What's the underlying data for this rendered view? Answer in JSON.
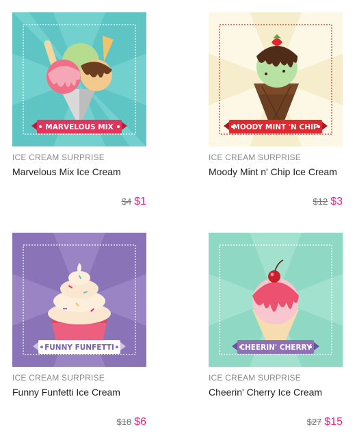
{
  "products": [
    {
      "category": "ICE CREAM SURPRISE",
      "name": "Marvelous Mix Ice Cream",
      "badge": "MARVELOUS MIX",
      "old_price": "$4",
      "price": "$1",
      "bg_color": "#5ec4c4",
      "ray_color": "#72d0cf",
      "ribbon_color": "#e4345b",
      "illustration": "three-scoop-cone"
    },
    {
      "category": "ICE CREAM SURPRISE",
      "name": "Moody Mint n' Chip Ice Cream",
      "badge": "MOODY MINT 'N CHIP",
      "old_price": "$12",
      "price": "$3",
      "bg_color": "#fdf8e6",
      "ray_color": "#f6edcc",
      "ribbon_color": "#e0282f",
      "illustration": "mint-chocolate-cone"
    },
    {
      "category": "ICE CREAM SURPRISE",
      "name": "Funny Funfetti Ice Cream",
      "badge": "FUNNY FUNFETTI",
      "old_price": "$18",
      "price": "$6",
      "bg_color": "#8b73b8",
      "ray_color": "#9a84c4",
      "ribbon_color": "#ffffff",
      "illustration": "sprinkle-cupcake"
    },
    {
      "category": "ICE CREAM SURPRISE",
      "name": "Cheerin' Cherry Ice Cream",
      "badge": "CHEERIN' CHERRY",
      "old_price": "$27",
      "price": "$15",
      "bg_color": "#8fd8c3",
      "ray_color": "#a3e1cf",
      "ribbon_color": "#8f72b5",
      "illustration": "cherry-cone"
    }
  ]
}
